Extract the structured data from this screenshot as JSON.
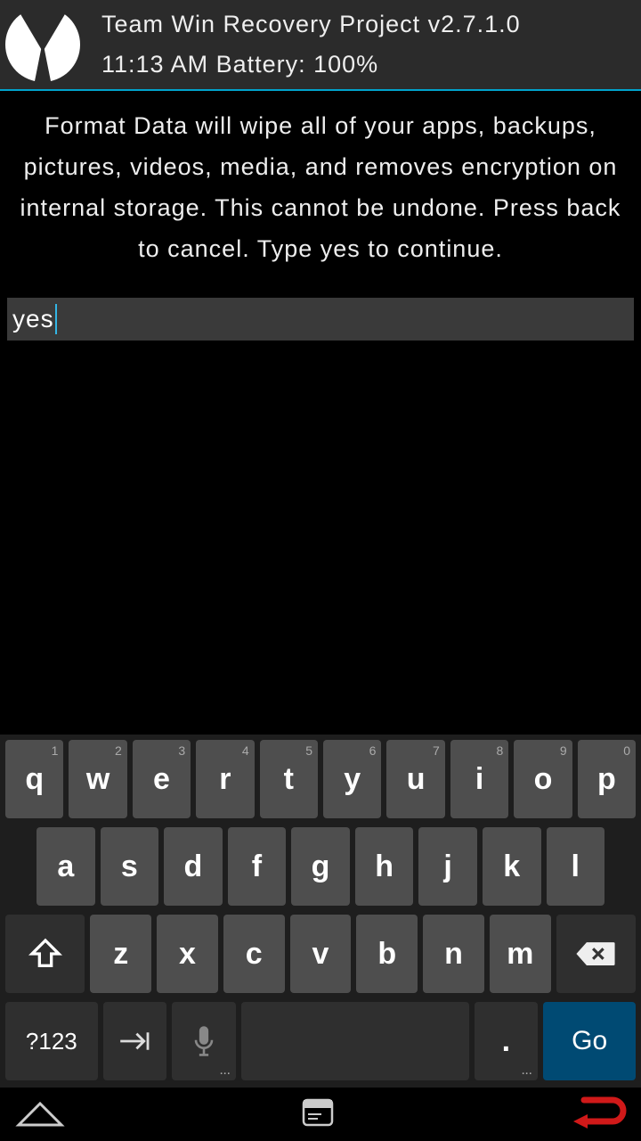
{
  "header": {
    "title": "Team Win Recovery Project  v2.7.1.0",
    "status": "11:13 AM  Battery: 100%"
  },
  "warning": {
    "text": "Format Data will wipe all of your apps, backups, pictures, videos, media, and removes encryption on internal storage. This cannot be undone. Press back to cancel. Type yes to continue."
  },
  "input": {
    "value": "yes"
  },
  "keyboard": {
    "row1": [
      {
        "label": "q",
        "num": "1"
      },
      {
        "label": "w",
        "num": "2"
      },
      {
        "label": "e",
        "num": "3"
      },
      {
        "label": "r",
        "num": "4"
      },
      {
        "label": "t",
        "num": "5"
      },
      {
        "label": "y",
        "num": "6"
      },
      {
        "label": "u",
        "num": "7"
      },
      {
        "label": "i",
        "num": "8"
      },
      {
        "label": "o",
        "num": "9"
      },
      {
        "label": "p",
        "num": "0"
      }
    ],
    "row2": [
      {
        "label": "a"
      },
      {
        "label": "s"
      },
      {
        "label": "d"
      },
      {
        "label": "f"
      },
      {
        "label": "g"
      },
      {
        "label": "h"
      },
      {
        "label": "j"
      },
      {
        "label": "k"
      },
      {
        "label": "l"
      }
    ],
    "row3": [
      {
        "label": "z"
      },
      {
        "label": "x"
      },
      {
        "label": "c"
      },
      {
        "label": "v"
      },
      {
        "label": "b"
      },
      {
        "label": "n"
      },
      {
        "label": "m"
      }
    ],
    "sym": "?123",
    "period": ".",
    "go": "Go"
  }
}
